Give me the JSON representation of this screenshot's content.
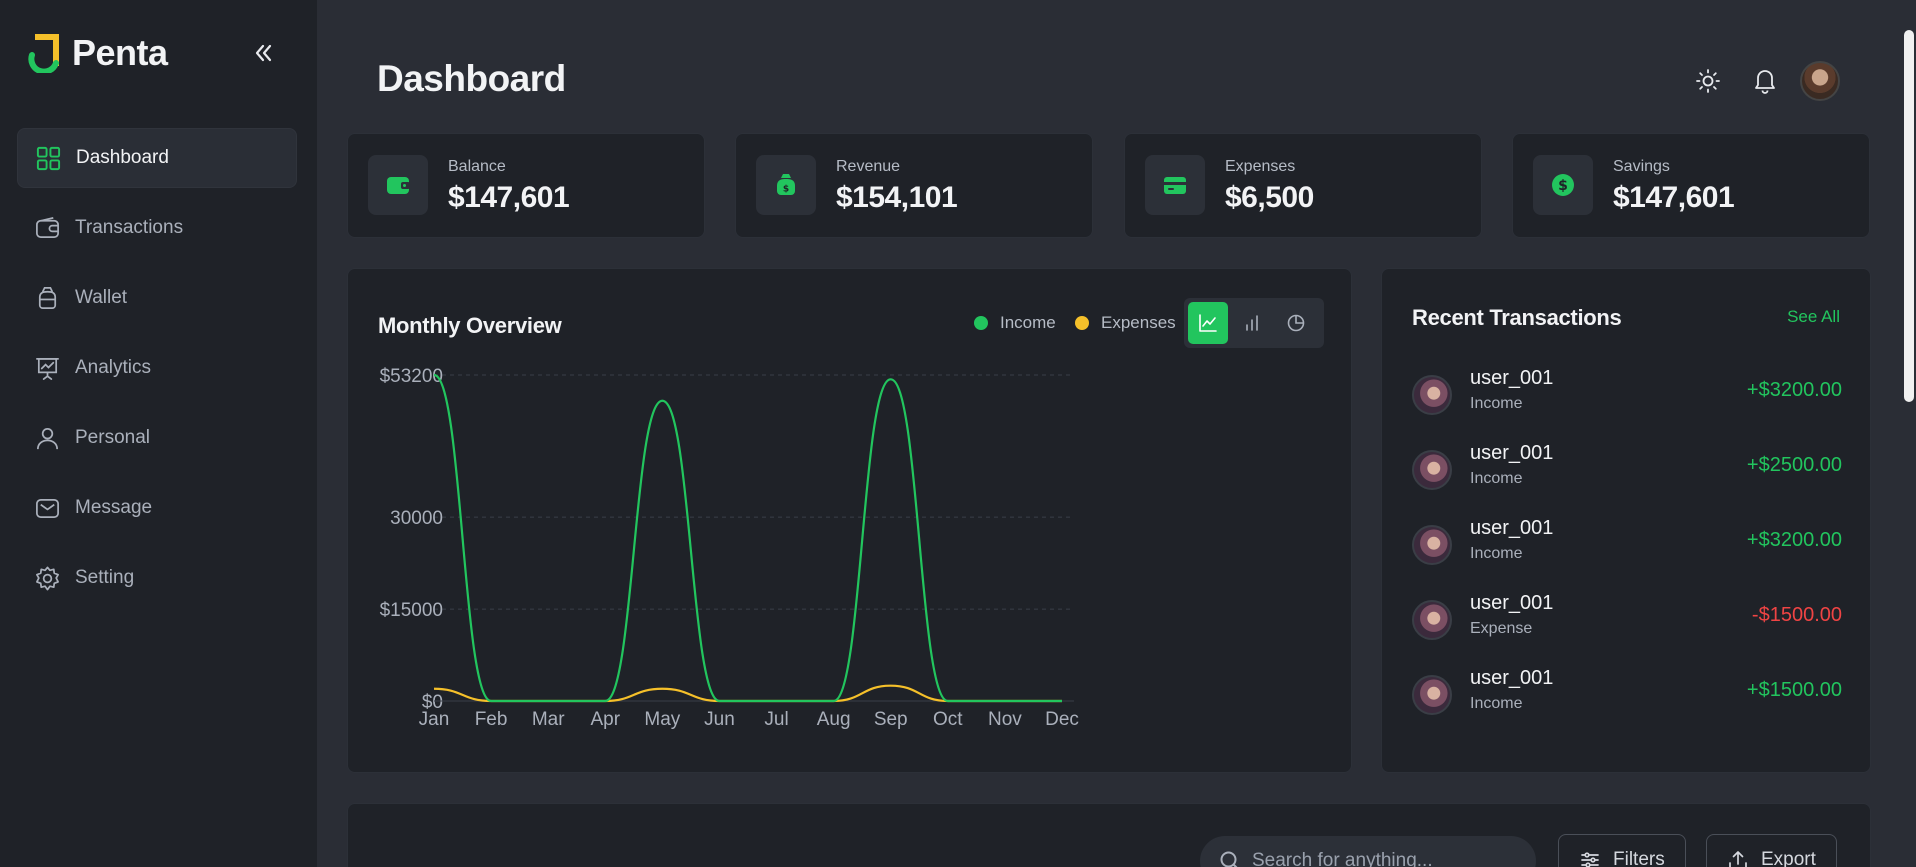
{
  "app": {
    "name": "Penta"
  },
  "sidebar": {
    "items": [
      {
        "label": "Dashboard",
        "icon": "grid-icon",
        "active": true
      },
      {
        "label": "Transactions",
        "icon": "wallet-card-icon"
      },
      {
        "label": "Wallet",
        "icon": "money-bag-icon"
      },
      {
        "label": "Analytics",
        "icon": "presentation-chart-icon"
      },
      {
        "label": "Personal",
        "icon": "user-icon"
      },
      {
        "label": "Message",
        "icon": "mail-icon"
      },
      {
        "label": "Setting",
        "icon": "gear-icon"
      }
    ]
  },
  "header": {
    "title": "Dashboard"
  },
  "stats": [
    {
      "label": "Balance",
      "value": "$147,601",
      "icon": "wallet-icon"
    },
    {
      "label": "Revenue",
      "value": "$154,101",
      "icon": "money-bag-icon"
    },
    {
      "label": "Expenses",
      "value": "$6,500",
      "icon": "credit-card-icon"
    },
    {
      "label": "Savings",
      "value": "$147,601",
      "icon": "dollar-coin-icon"
    }
  ],
  "overview": {
    "title": "Monthly Overview",
    "legend": {
      "income": "Income",
      "expenses": "Expenses"
    }
  },
  "chart_data": {
    "type": "line",
    "categories": [
      "Jan",
      "Feb",
      "Mar",
      "Apr",
      "May",
      "Jun",
      "Jul",
      "Aug",
      "Sep",
      "Oct",
      "Nov",
      "Dec"
    ],
    "series": [
      {
        "name": "Income",
        "color": "#22c55e",
        "values": [
          53200,
          0,
          0,
          0,
          49000,
          0,
          0,
          0,
          52500,
          0,
          0,
          0
        ]
      },
      {
        "name": "Expenses",
        "color": "#f5c02a",
        "values": [
          2000,
          0,
          0,
          0,
          2000,
          0,
          0,
          0,
          2500,
          0,
          0,
          0
        ]
      }
    ],
    "yticks": [
      {
        "value": 53200,
        "label": "$53200"
      },
      {
        "value": 30000,
        "label": "30000"
      },
      {
        "value": 15000,
        "label": "$15000"
      },
      {
        "value": 0,
        "label": "$0"
      }
    ],
    "ylim": [
      0,
      53200
    ],
    "grid": true
  },
  "recent": {
    "title": "Recent Transactions",
    "see_all": "See All",
    "items": [
      {
        "name": "user_001",
        "type": "Income",
        "amount": "+$3200.00",
        "color": "#22c55e"
      },
      {
        "name": "user_001",
        "type": "Income",
        "amount": "+$2500.00",
        "color": "#22c55e"
      },
      {
        "name": "user_001",
        "type": "Income",
        "amount": "+$3200.00",
        "color": "#22c55e"
      },
      {
        "name": "user_001",
        "type": "Expense",
        "amount": "-$1500.00",
        "color": "#ef4444"
      },
      {
        "name": "user_001",
        "type": "Income",
        "amount": "+$1500.00",
        "color": "#22c55e"
      }
    ]
  },
  "toolbar": {
    "search_placeholder": "Search for anything...",
    "filters": "Filters",
    "export": "Export"
  },
  "colors": {
    "accent": "#22c55e",
    "expense": "#f5c02a",
    "negative": "#ef4444"
  }
}
